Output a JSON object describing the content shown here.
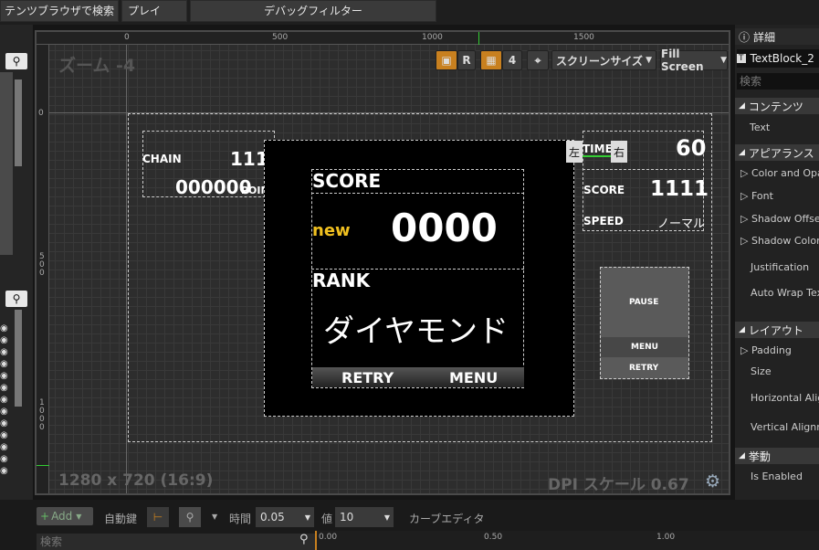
{
  "topbar": {
    "content_search": "テンツブラウザで検索",
    "play": "プレイ",
    "debug_filter": "デバッグフィルター"
  },
  "viewport": {
    "zoom": "ズーム -4",
    "resolution": "1280 x 720 (16:9)",
    "dpi": "DPI スケール 0.67",
    "ruler_h": [
      "0",
      "500",
      "1000",
      "1500"
    ],
    "ruler_v": [
      "0",
      "5\n0\n0",
      "1\n0\n0\n0"
    ],
    "toolbar": {
      "r": "R",
      "grid_num": "4",
      "screen_size": "スクリーンサイズ",
      "fill_screen": "Fill Screen"
    }
  },
  "hud": {
    "chain_label": "CHAIN",
    "chain_value": "1111",
    "point_value": "000000",
    "point_label": "POINT",
    "time_label": "TIME",
    "left": "左",
    "right": "右",
    "time_value": "60",
    "score_label": "SCORE",
    "score_value": "1111",
    "speed_label": "SPEED",
    "speed_value": "ノーマル"
  },
  "result": {
    "score_label": "SCORE",
    "new_label": "new",
    "score_value": "0000",
    "rank_label": "RANK",
    "rank_value": "ダイヤモンド",
    "retry": "RETRY",
    "menu": "MENU"
  },
  "pause_menu": {
    "pause": "PAUSE",
    "menu": "MENU",
    "retry": "RETRY"
  },
  "details": {
    "tab": "詳細",
    "widget_name": "TextBlock_2",
    "search_placeholder": "検索",
    "sections": {
      "content": "コンテンツ",
      "appearance": "アピアランス",
      "layout": "レイアウト",
      "behavior": "挙動"
    },
    "items": {
      "text": "Text",
      "color": "Color and Opac",
      "font": "Font",
      "shadow_offset": "Shadow Offset",
      "shadow_color": "Shadow Color",
      "justification": "Justification",
      "autowrap": "Auto Wrap Text",
      "padding": "Padding",
      "size": "Size",
      "h_align": "Horizontal Alig",
      "v_align": "Vertical Alignm",
      "enabled": "Is Enabled"
    }
  },
  "bottom": {
    "add": "Add",
    "autokey": "自動鍵",
    "time_label": "時間",
    "time_value": "0.05",
    "value_label": "値",
    "value_value": "10",
    "curve_editor": "カーブエディタ",
    "search_placeholder": "検索",
    "ticks": [
      "0.00",
      "0.50",
      "1.00"
    ]
  }
}
